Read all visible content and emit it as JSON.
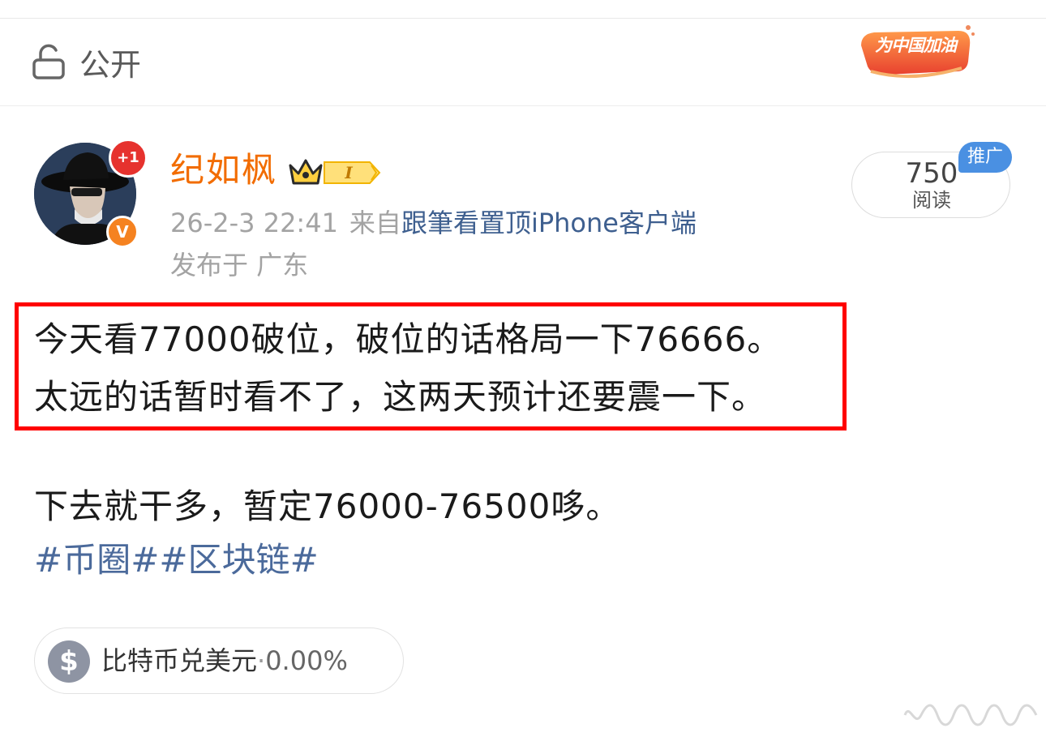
{
  "visibility": {
    "label": "公开",
    "icon": "lock-open-icon"
  },
  "promo_badge": {
    "text": "为中国加油"
  },
  "author": {
    "name": "纪如枫",
    "plus_badge": "+1",
    "verified_badge": "V",
    "level_badge": "I"
  },
  "post_meta": {
    "time": "26-2-3 22:41",
    "from_label": "来自",
    "source": "跟筆看置顶iPhone客户端",
    "location": "发布于 广东"
  },
  "stats": {
    "views": "750",
    "views_label": "阅读",
    "promo_tag": "推广"
  },
  "content": {
    "line1": "今天看77000破位，破位的话格局一下76666。",
    "line2": "太远的话暂时看不了，这两天预计还要震一下。",
    "line3": "下去就干多，暂定76000-76500哆。",
    "hashtags": "#币圈##区块链#"
  },
  "ticker": {
    "name": "比特币兑美元",
    "separator": "·",
    "change": "0.00%"
  },
  "colors": {
    "username": "#f26c00",
    "link": "#3e5f8f",
    "highlight": "#ff0000",
    "promo_tag": "#4a90e2"
  }
}
